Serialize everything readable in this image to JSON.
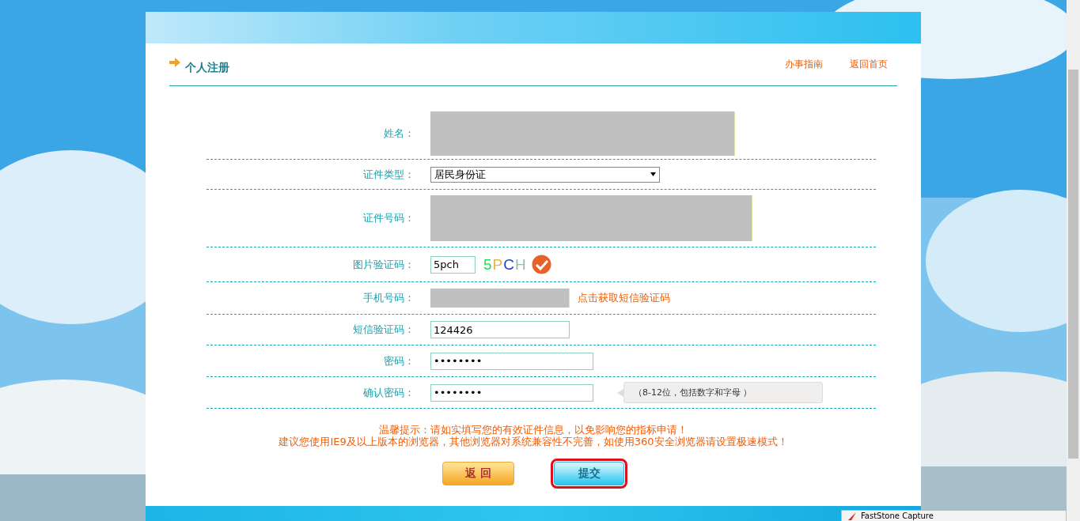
{
  "header": {
    "title": "个人注册",
    "links": [
      "办事指南",
      "返回首页"
    ]
  },
  "form": {
    "fields": [
      {
        "kind": "masked-wide",
        "label": "姓名："
      },
      {
        "kind": "select",
        "label": "证件类型：",
        "value": "居民身份证"
      },
      {
        "kind": "masked-wide",
        "label": "证件号码："
      },
      {
        "kind": "captcha",
        "label": "图片验证码：",
        "value": "5pch",
        "captcha": "5PCH",
        "verified": true
      },
      {
        "kind": "masked",
        "label": "手机号码：",
        "action": "点击获取短信验证码"
      },
      {
        "kind": "text",
        "label": "短信验证码：",
        "value": "124426"
      },
      {
        "kind": "password",
        "label": "密码：",
        "value": "••••••••"
      },
      {
        "kind": "password",
        "label": "确认密码：",
        "value": "••••••••",
        "hint": "（8-12位，包括数字和字母 ）"
      }
    ]
  },
  "notes": [
    "温馨提示：请如实填写您的有效证件信息，以免影响您的指标申请！",
    "建议您使用IE9及以上版本的浏览器，其他浏览器对系统兼容性不完善，如使用360安全浏览器请设置极速模式！"
  ],
  "buttons": [
    {
      "kind": "back",
      "label": "返 回",
      "highlighted": false
    },
    {
      "kind": "submit",
      "label": "提交",
      "highlighted": true
    }
  ],
  "taskbar_window": {
    "title": "FastStone Capture"
  }
}
